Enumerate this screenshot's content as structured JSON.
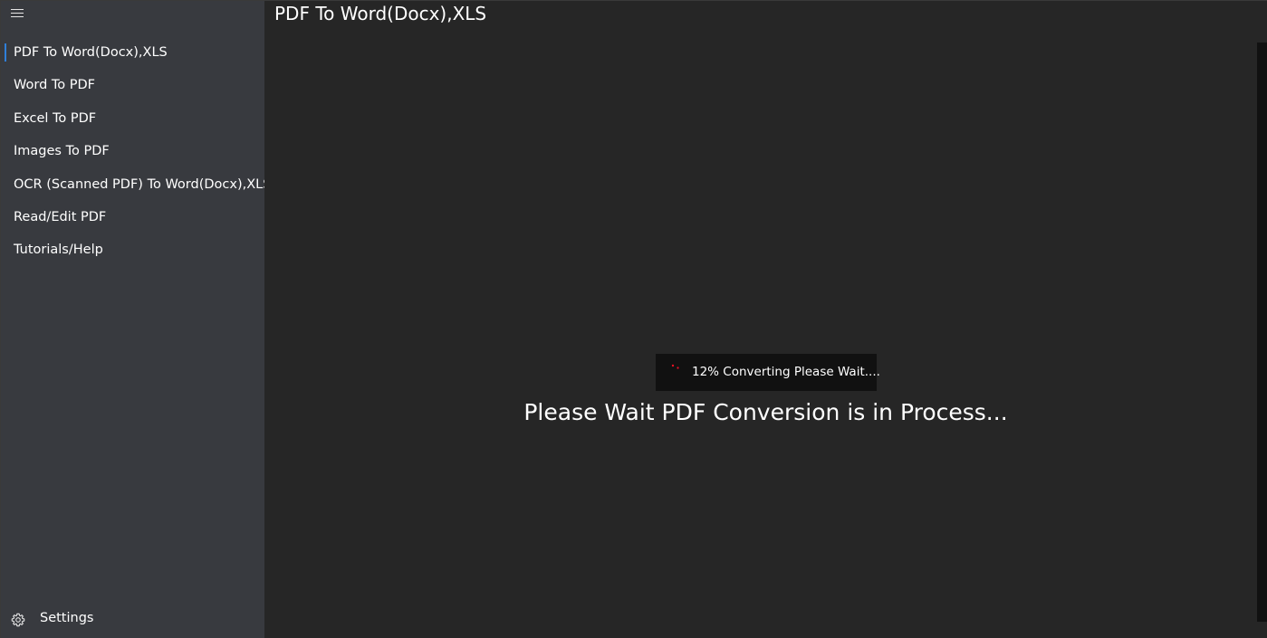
{
  "sidebar": {
    "menu_icon": "hamburger-icon",
    "items": [
      {
        "label": "PDF To Word(Docx),XLS",
        "selected": true
      },
      {
        "label": "Word To PDF",
        "selected": false
      },
      {
        "label": "Excel To PDF",
        "selected": false
      },
      {
        "label": "Images To PDF",
        "selected": false
      },
      {
        "label": "OCR (Scanned PDF) To Word(Docx),XLS",
        "selected": false
      },
      {
        "label": "Read/Edit PDF",
        "selected": false
      },
      {
        "label": "Tutorials/Help",
        "selected": false
      }
    ],
    "settings": {
      "icon": "gear-icon",
      "label": "Settings"
    }
  },
  "main": {
    "title": "PDF To Word(Docx),XLS",
    "progress": {
      "percent": 12,
      "text": "12% Converting Please Wait....",
      "spinner_icon": "spinner-icon"
    },
    "message": "Please Wait PDF Conversion is in Process..."
  },
  "colors": {
    "sidebar_bg": "#383a3f",
    "main_bg": "#262626",
    "accent": "#2f7fd9",
    "spinner": "#e81123",
    "progress_bg": "#111111"
  }
}
